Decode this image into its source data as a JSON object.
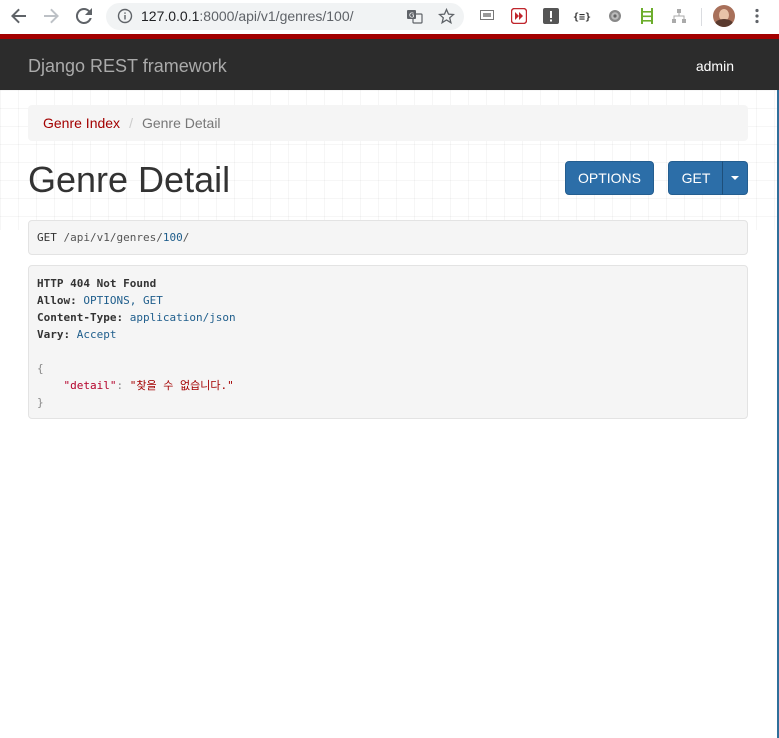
{
  "browser": {
    "url_host": "127.0.0.1",
    "url_path": ":8000/api/v1/genres/100/"
  },
  "navbar": {
    "brand": "Django REST framework",
    "user": "admin"
  },
  "breadcrumb": {
    "items": [
      {
        "label": "Genre Index"
      },
      {
        "label": "Genre Detail"
      }
    ],
    "separator": "/"
  },
  "page": {
    "title": "Genre Detail",
    "options_label": "OPTIONS",
    "get_label": "GET"
  },
  "request": {
    "method": "GET",
    "path_prefix": "/api/v1/genres/",
    "path_id": "100",
    "path_suffix": "/"
  },
  "response": {
    "status": "HTTP 404 Not Found",
    "headers": [
      {
        "name": "Allow:",
        "value": "OPTIONS, GET"
      },
      {
        "name": "Content-Type:",
        "value": "application/json"
      },
      {
        "name": "Vary:",
        "value": "Accept"
      }
    ],
    "body": {
      "open": "{",
      "key": "\"detail\"",
      "colon": ": ",
      "value": "\"찾을 수 없습니다.\"",
      "close": "}"
    }
  },
  "colors": {
    "navbar_accent": "#a30000",
    "navbar_bg": "#2c2c2c",
    "button_bg": "#2c6ea8",
    "link": "#a30000"
  }
}
